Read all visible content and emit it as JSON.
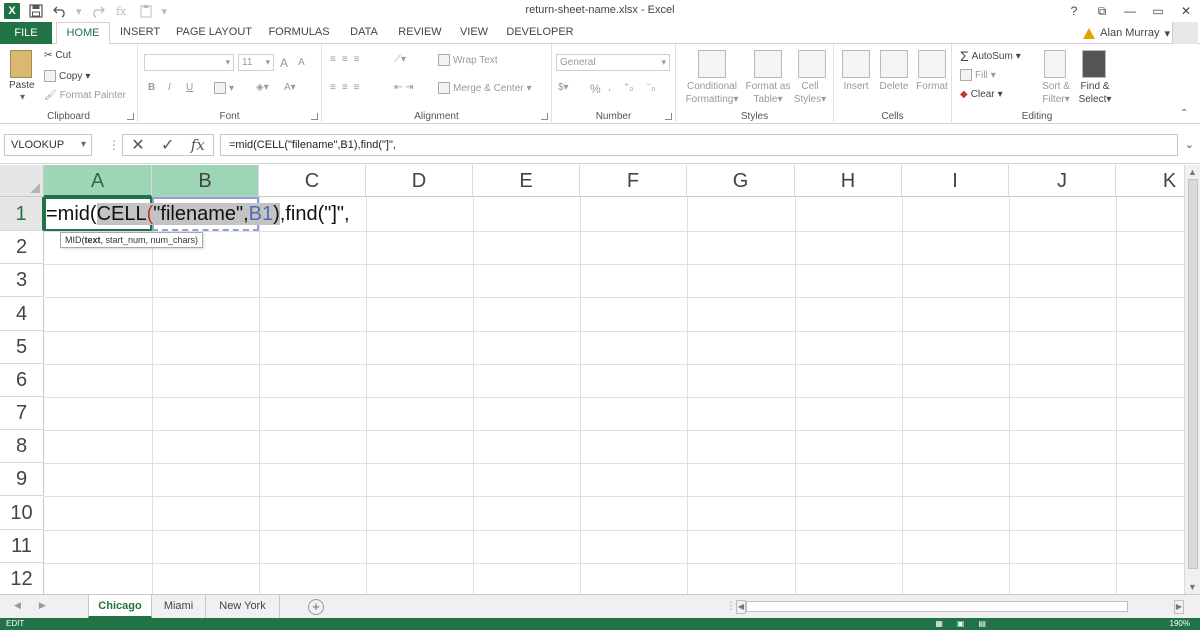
{
  "window": {
    "title": "return-sheet-name.xlsx - Excel",
    "controls": [
      "?",
      "⧉",
      "—",
      "▭",
      "✕"
    ]
  },
  "qat": {
    "app_icon": "X",
    "customize": "▾"
  },
  "tabs": [
    "FILE",
    "HOME",
    "INSERT",
    "PAGE LAYOUT",
    "FORMULAS",
    "DATA",
    "REVIEW",
    "VIEW",
    "DEVELOPER"
  ],
  "user": {
    "name": "Alan Murray",
    "caret": "▾"
  },
  "ribbon": {
    "clipboard": {
      "paste": "Paste",
      "cut": "Cut",
      "copy": "Copy",
      "format_painter": "Format Painter",
      "label": "Clipboard"
    },
    "font": {
      "size": "11",
      "label": "Font",
      "bold": "B",
      "italic": "I",
      "underline": "U",
      "grow": "A",
      "shrink": "A"
    },
    "alignment": {
      "wrap_text": "Wrap Text",
      "merge_center": "Merge & Center",
      "label": "Alignment"
    },
    "number": {
      "format": "General",
      "percent": "%",
      "label": "Number"
    },
    "styles": {
      "conditional": "Conditional",
      "conditional2": "Formatting",
      "format_as": "Format as",
      "format_as2": "Table",
      "cell": "Cell",
      "cell2": "Styles",
      "label": "Styles"
    },
    "cells": {
      "insert": "Insert",
      "delete": "Delete",
      "format": "Format",
      "label": "Cells"
    },
    "editing": {
      "autosum": "AutoSum",
      "fill": "Fill",
      "clear": "Clear",
      "sort": "Sort &",
      "sort2": "Filter",
      "find": "Find &",
      "find2": "Select",
      "label": "Editing"
    }
  },
  "formula_bar": {
    "name_box": "VLOOKUP",
    "cancel": "✕",
    "enter": "✓",
    "fx": "fx",
    "formula": "=mid(CELL(\"filename\",B1),find(\"]\","
  },
  "grid": {
    "columns": [
      "A",
      "B",
      "C",
      "D",
      "E",
      "F",
      "G",
      "H",
      "I",
      "J",
      "K"
    ],
    "rows": [
      "1",
      "2",
      "3",
      "4",
      "5",
      "6",
      "7",
      "8",
      "9",
      "10",
      "11",
      "12"
    ],
    "active_cell": "A1",
    "edit_parts": {
      "p1": "=mid(",
      "p2": "CELL",
      "p3": "(",
      "p4": "\"filename\",",
      "p5": "B1",
      "p6": ")",
      "p7": ",find(",
      "p8": "\"]\","
    },
    "tooltip": {
      "fn": "MID(",
      "arg1": "text",
      "rest": ", start_num, num_chars)"
    }
  },
  "sheets": [
    "Chicago",
    "Miami",
    "New York"
  ],
  "active_sheet": "Chicago",
  "status": {
    "mode": "EDIT",
    "zoom": "190%"
  },
  "colors": {
    "accent": "#217346",
    "selected_header": "#9fd5b7",
    "ref_blue": "#4a6fb5"
  }
}
